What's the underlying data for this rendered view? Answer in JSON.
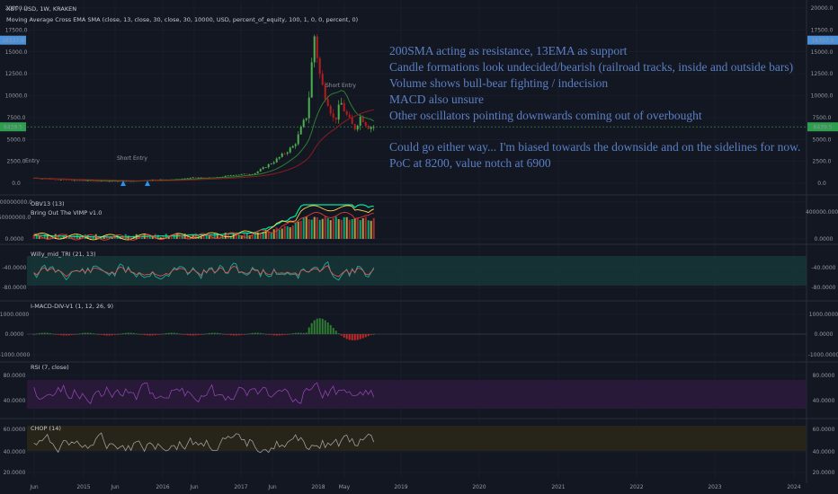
{
  "colors": {
    "background": "#131722",
    "grid": "#1e2230",
    "candle_up": "#4caf50",
    "candle_down": "#b71c1c",
    "sma": "#8a1c1c",
    "ema": "#2e7d32",
    "annotation": "#5b7fc4",
    "price_blue": "#4a90d9",
    "price_green": "#2e9e4f",
    "rsi_band": "#2a1a3a",
    "rsi_line": "#8e44ad",
    "chop_band": "#2a2618",
    "chop_line": "#9e9e9e",
    "willy_band": "#16383a",
    "willy_line": "#26a69a",
    "obv_green": "#00e5a0",
    "obv_yellow": "#ffd54f",
    "obv_red": "#e53935",
    "macd_green": "#2e7d32",
    "macd_red": "#c62828"
  },
  "annotations": [
    "200SMA acting as resistance, 13EMA as support",
    "Candle formations look undecided/bearish (railroad tracks, inside and outside bars)",
    "Volume shows bull-bear fighting / indecision",
    "MACD also unsure",
    "Other oscillators pointing downwards coming out of overbought",
    "Could go either way... I'm biased towards the downside and on the sidelines for now.",
    "PoC at 8200, value notch at 6900"
  ],
  "chart_data": [
    {
      "type": "candlestick",
      "title": "XBT / USD, 1W, KRAKEN",
      "subtitle": "Moving Average Cross EMA SMA (close, 13, close, 30, close, 30, 10000, USD, percent_of_equity, 100, 1, 0, 0, percent, 0)",
      "ylim": [
        0,
        20000
      ],
      "y_ticks": [
        "20000.0",
        "17500.0",
        "15000.0",
        "12500.0",
        "10000.0",
        "7500.0",
        "5000.0",
        "2500.0",
        "0.0"
      ],
      "price_labels": [
        {
          "text": "16337.9",
          "value": 16337.9,
          "color": "blue"
        },
        {
          "text": "6439.5",
          "value": 6439.5,
          "color": "green"
        }
      ],
      "signal_labels": [
        "Entry",
        "Short Entry",
        "Short Entry"
      ],
      "x_ticks": [
        "Jun",
        "2015",
        "Jun",
        "2016",
        "Jun",
        "2017",
        "Jun",
        "2018",
        "May",
        "2019",
        "2020",
        "2021",
        "2022",
        "2023",
        "2024"
      ],
      "series": [
        {
          "name": "price",
          "x": [
            "2014-06",
            "2014-09",
            "2014-12",
            "2015-03",
            "2015-06",
            "2015-09",
            "2015-12",
            "2016-03",
            "2016-06",
            "2016-09",
            "2016-12",
            "2017-03",
            "2017-06",
            "2017-09",
            "2017-11",
            "2017-12",
            "2018-01",
            "2018-02",
            "2018-03",
            "2018-04",
            "2018-05",
            "2018-06",
            "2018-07",
            "2018-08",
            "2018-09"
          ],
          "values": [
            600,
            450,
            320,
            260,
            250,
            240,
            430,
            420,
            650,
            610,
            960,
            1100,
            2500,
            4300,
            8000,
            17000,
            11500,
            9500,
            7000,
            9200,
            7500,
            6200,
            7700,
            6500,
            6439
          ]
        }
      ]
    },
    {
      "type": "line",
      "title": "OBV13 (13)",
      "subtitle": "Bring Out The VIMP v1.0",
      "y_ticks_left": [
        "100000000.0",
        "50000000.0",
        "0.0000"
      ],
      "y_ticks_right": [
        "400000.0000",
        "0.0000"
      ]
    },
    {
      "type": "line",
      "title": "Willy_mid_TRI (21, 13)",
      "y_ticks": [
        "-40.0000",
        "-80.0000"
      ]
    },
    {
      "type": "bar",
      "title": "I-MACD-DIV-V1 (1, 12, 26, 9)",
      "y_ticks": [
        "1000.0000",
        "0.0000",
        "-1000.0000"
      ]
    },
    {
      "type": "line",
      "title": "RSI (7, close)",
      "y_ticks": [
        "80.0000",
        "40.0000"
      ]
    },
    {
      "type": "line",
      "title": "CHOP (14)",
      "y_ticks": [
        "60.0000",
        "40.0000",
        "20.0000"
      ]
    }
  ]
}
